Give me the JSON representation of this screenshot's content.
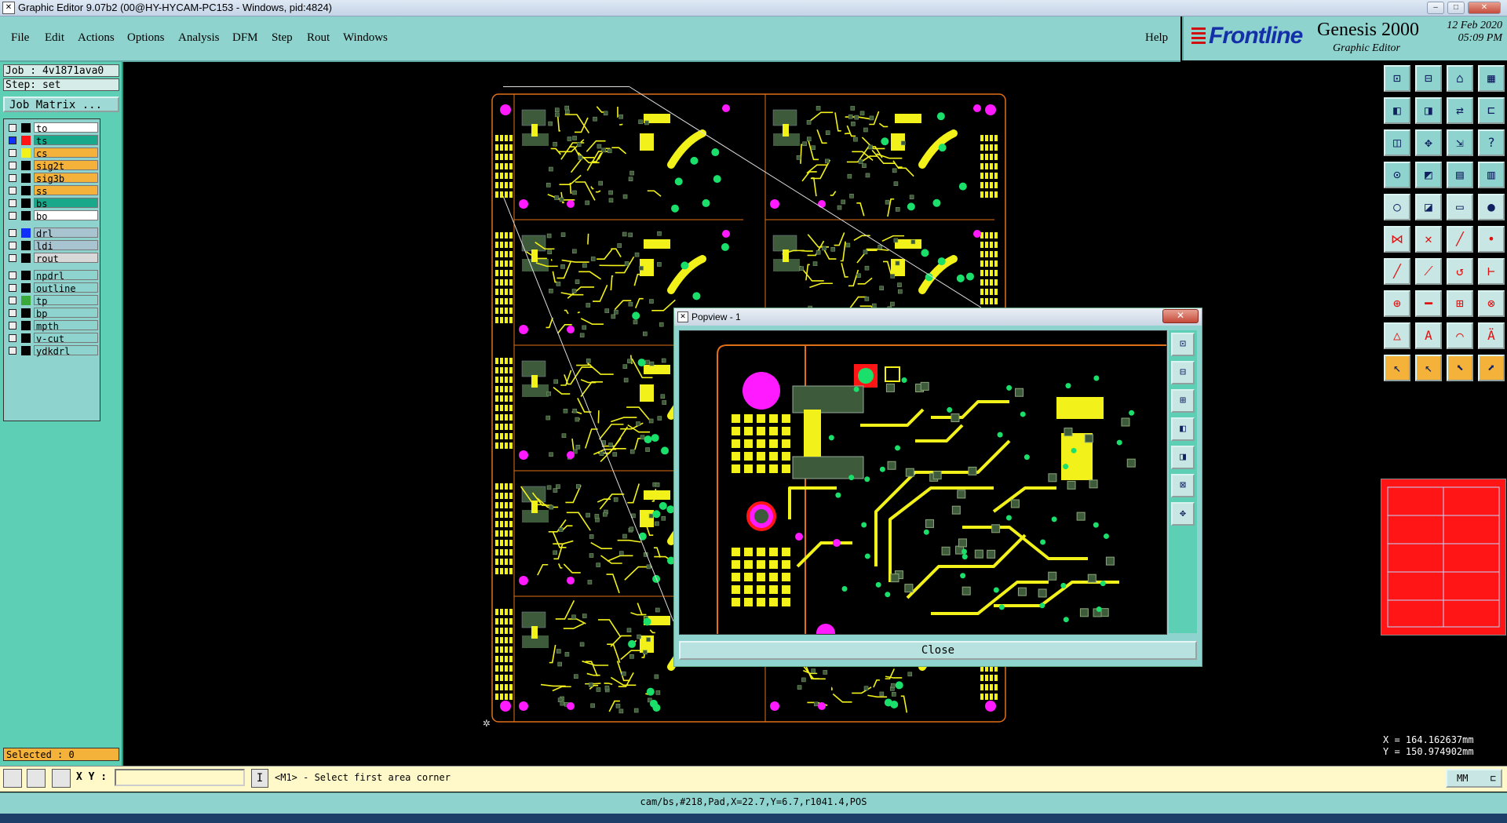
{
  "window": {
    "title": "Graphic Editor 9.07b2 (00@HY-HYCAM-PC153 - Windows, pid:4824)",
    "controls": [
      "–",
      "□",
      "✕"
    ]
  },
  "menu": {
    "items": [
      "File",
      "Edit",
      "Actions",
      "Options",
      "Analysis",
      "DFM",
      "Step",
      "Rout",
      "Windows"
    ],
    "help": "Help"
  },
  "brand": {
    "logo": "Frontline",
    "product": "Genesis 2000",
    "subtitle": "Graphic Editor",
    "date": "12 Feb 2020",
    "time": "05:09 PM"
  },
  "job": {
    "job_label": "Job : 4v1871ava0",
    "step_label": "Step: set",
    "matrix_button": "Job Matrix ..."
  },
  "layers": [
    {
      "name": "to",
      "color": "#000000",
      "bg": "#ffffff"
    },
    {
      "name": "ts",
      "color": "#ff1515",
      "bg": "#1aa88a",
      "active": true
    },
    {
      "name": "cs",
      "color": "#f2f21a",
      "bg": "#f5b23a"
    },
    {
      "name": "sig2t",
      "color": "#000000",
      "bg": "#f5b23a"
    },
    {
      "name": "sig3b",
      "color": "#000000",
      "bg": "#f5b23a"
    },
    {
      "name": "ss",
      "color": "#000000",
      "bg": "#f5b23a"
    },
    {
      "name": "bs",
      "color": "#000000",
      "bg": "#1aa88a"
    },
    {
      "name": "bo",
      "color": "#000000",
      "bg": "#ffffff"
    },
    {
      "name": "drl",
      "color": "#1030ff",
      "bg": "#a8c4d0"
    },
    {
      "name": "ldi",
      "color": "#000000",
      "bg": "#a8c4d0"
    },
    {
      "name": "rout",
      "color": "#000000",
      "bg": "#d8d8d8"
    },
    {
      "name": "npdrl",
      "color": "#000000",
      "bg": "#8fd3cf"
    },
    {
      "name": "outline",
      "color": "#000000",
      "bg": "#8fd3cf"
    },
    {
      "name": "tp",
      "color": "#3aa83a",
      "bg": "#8fd3cf"
    },
    {
      "name": "bp",
      "color": "#000000",
      "bg": "#8fd3cf"
    },
    {
      "name": "mpth",
      "color": "#000000",
      "bg": "#8fd3cf"
    },
    {
      "name": "v-cut",
      "color": "#000000",
      "bg": "#8fd3cf"
    },
    {
      "name": "ydkdrl",
      "color": "#000000",
      "bg": "#8fd3cf"
    }
  ],
  "selection": {
    "label": "Selected : 0"
  },
  "popview": {
    "title": "Popview - 1",
    "close_label": "Close"
  },
  "coords": {
    "x": "X = 164.162637mm",
    "y": "Y = 150.974902mm"
  },
  "command": {
    "xy_label": "X Y :",
    "xy_value": "",
    "prompt": "<M1> - Select first area corner",
    "units": "MM"
  },
  "status": {
    "text": "cam/bs,#218,Pad,X=22.7,Y=6.7,r1041.4,POS"
  },
  "colors": {
    "panel": "#8fd3cf",
    "panel_dark": "#5ccfb4",
    "copper": "#f2f21a",
    "mask": "#3d5a3a",
    "pad_magenta": "#ff1aff",
    "pad_green": "#1adf6a",
    "route": "#e0701a"
  },
  "tool_icons": [
    "zoom-home-icon",
    "zoom-window-icon",
    "home-icon",
    "layout-icon",
    "pan-left-icon",
    "pan-right-icon",
    "flip-icon",
    "snap-icon",
    "fit-icon",
    "center-icon",
    "scale-icon",
    "help-icon",
    "measure-icon",
    "probe-icon",
    "layers-icon",
    "layers-alt-icon",
    "circle-icon",
    "shape-icon",
    "ruler-icon",
    "pad-icon",
    "net-icon",
    "cross-icon",
    "line-icon",
    "point-icon",
    "line-draw-icon",
    "slash-icon",
    "arc-icon",
    "dim-icon",
    "pad-add-icon",
    "dash-icon",
    "array-icon",
    "group-icon",
    "triangle-icon",
    "text-a-icon",
    "text-arc-icon",
    "text-b-icon",
    "select-icon",
    "select-alt-icon",
    "select-box-icon",
    "select-net-icon"
  ]
}
